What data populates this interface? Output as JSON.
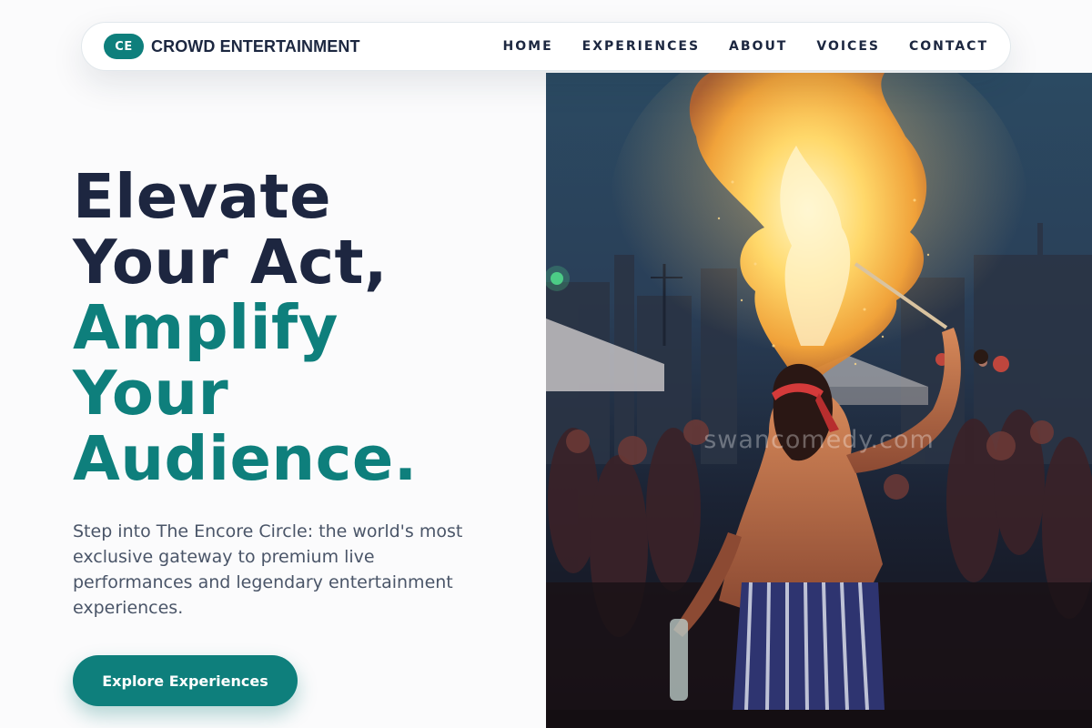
{
  "brand": {
    "badge": "CE",
    "name": "CROWD ENTERTAINMENT"
  },
  "nav": {
    "items": [
      {
        "label": "HOME"
      },
      {
        "label": "EXPERIENCES"
      },
      {
        "label": "ABOUT"
      },
      {
        "label": "VOICES"
      },
      {
        "label": "CONTACT"
      }
    ]
  },
  "hero": {
    "headline_line1": "Elevate",
    "headline_line2": "Your Act,",
    "headline_line3": "Amplify",
    "headline_line4": "Your",
    "headline_line5": "Audience.",
    "description": "Step into The Encore Circle: the world's most exclusive gateway to premium live performances and legendary entertainment experiences.",
    "cta_label": "Explore Experiences"
  },
  "image": {
    "subject": "fire-breather-performing-at-night-crowd",
    "watermark": "swancomedy.com"
  },
  "colors": {
    "accent": "#0e7f7c",
    "heading_dark": "#1d2640",
    "body_text": "#4a5568",
    "background": "#fbfbfc"
  }
}
